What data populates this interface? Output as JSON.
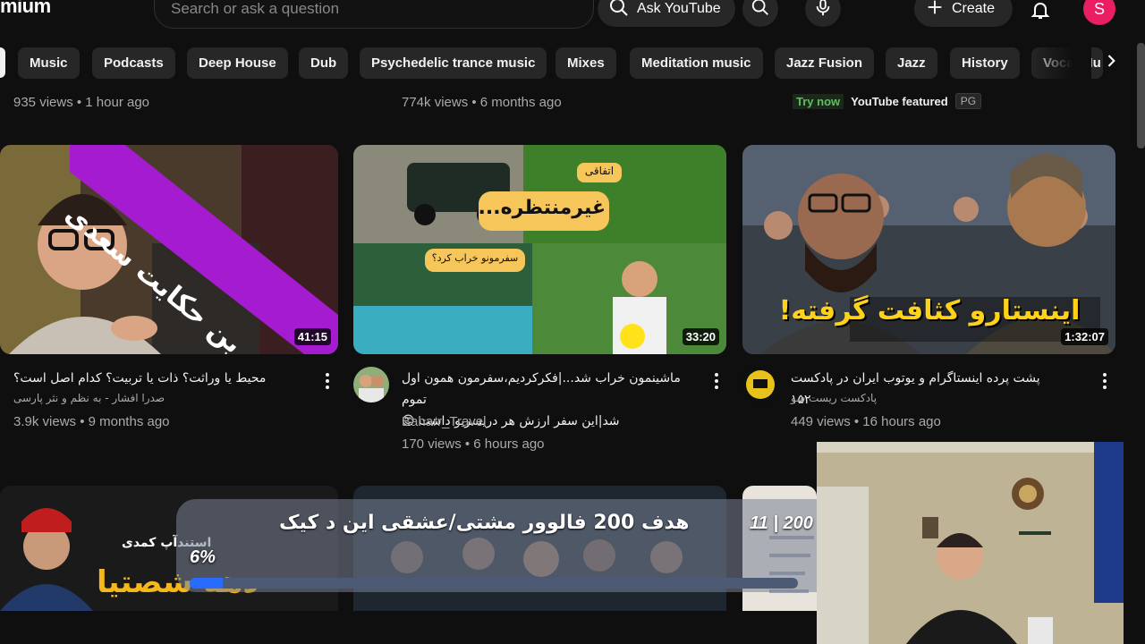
{
  "header": {
    "brand": "mium",
    "search_placeholder": "Search or ask a question",
    "ask_label": "Ask YouTube",
    "create_label": "Create",
    "avatar_letter": "S"
  },
  "chips": [
    "Music",
    "Podcasts",
    "Deep House",
    "Dub",
    "Psychedelic trance music",
    "Mixes",
    "Meditation music",
    "Jazz Fusion",
    "Jazz",
    "History",
    "Vocal Mu"
  ],
  "previous_row": {
    "meta_1": "935 views • 1 hour ago",
    "meta_2": "774k views • 6 months ago",
    "try_now": "Try now",
    "featured": "YouTube featured",
    "rating": "PG"
  },
  "videos": [
    {
      "duration": "41:15",
      "thumb_text": "زیباترین حکایت سعدی",
      "title": "محیط یا وراثت؟ ذات یا تربیت؟ کدام اصل است؟",
      "channel": "صدرا افشار - به نظم و نثر پارسی",
      "meta": "3.9k views • 9 months ago"
    },
    {
      "duration": "33:20",
      "thumb_text_1": "غیرمنتظره...",
      "thumb_text_2": "اتفاقی",
      "thumb_text_3": "سفرمونو خراب کرد؟",
      "title_line_1": "ماشینمون خراب شد...|فکرکردیم،سفرمون همون اول تموم",
      "title_line_2": "شد|این سفر ارزش هر دریسریو داشت 😊",
      "channel": "Baharr_Travel",
      "meta": "170 views • 6 hours ago"
    },
    {
      "duration": "1:32:07",
      "thumb_text": "اینستارو کثافت گرفته!",
      "title": "پشت پرده اینستاگرام و یوتوب ایران در پادکست ۱۵۲",
      "channel": "پادکست ریست شو",
      "meta": "449 views • 16 hours ago"
    }
  ],
  "bottom_row": {
    "thumb_text_1": "استندآپ کمدی",
    "thumb_text_2": "دهه شصتیا"
  },
  "overlay": {
    "title": "هدف 200 فالوور مشتی/عشقی این د کیک",
    "count": "11 | 200",
    "percent_label": "6%",
    "progress": 0.055
  }
}
